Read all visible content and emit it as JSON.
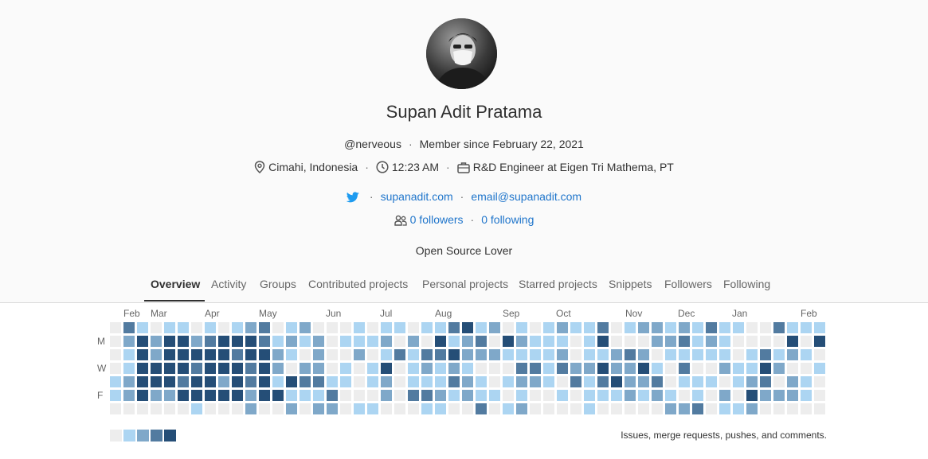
{
  "profile": {
    "name": "Supan Adit Pratama",
    "username": "@nerveous",
    "member_since": "Member since February 22, 2021",
    "location": "Cimahi, Indonesia",
    "local_time": "12:23 AM",
    "job": "R&D Engineer at Eigen Tri Mathema, PT",
    "website": "supanadit.com",
    "email": "email@supanadit.com",
    "followers": "0 followers",
    "following": "0 following",
    "bio": "Open Source Lover"
  },
  "icons": {
    "location": "map-pin-icon",
    "time": "clock-icon",
    "job": "briefcase-icon",
    "twitter": "twitter-icon",
    "followers": "users-icon"
  },
  "tabs": [
    {
      "label": "Overview",
      "active": true
    },
    {
      "label": "Activity"
    },
    {
      "label": "Groups"
    },
    {
      "label": "Contributed projects"
    },
    {
      "label": "Personal projects"
    },
    {
      "label": "Starred projects"
    },
    {
      "label": "Snippets"
    },
    {
      "label": "Followers"
    },
    {
      "label": "Following"
    }
  ],
  "colors": {
    "accent_link": "#1f75cb",
    "twitter": "#1d9bf0",
    "levels": [
      "#ededed",
      "#acd5f2",
      "#7fa8c9",
      "#527ba0",
      "#254e77"
    ]
  },
  "calendar": {
    "months": [
      "Feb",
      "Mar",
      "Apr",
      "May",
      "Jun",
      "Jul",
      "Aug",
      "Sep",
      "Oct",
      "Nov",
      "Dec",
      "Jan",
      "Feb"
    ],
    "day_labels": [
      "M",
      "W",
      "F"
    ],
    "legend_text": "Issues, merge requests, pushes, and comments."
  }
}
